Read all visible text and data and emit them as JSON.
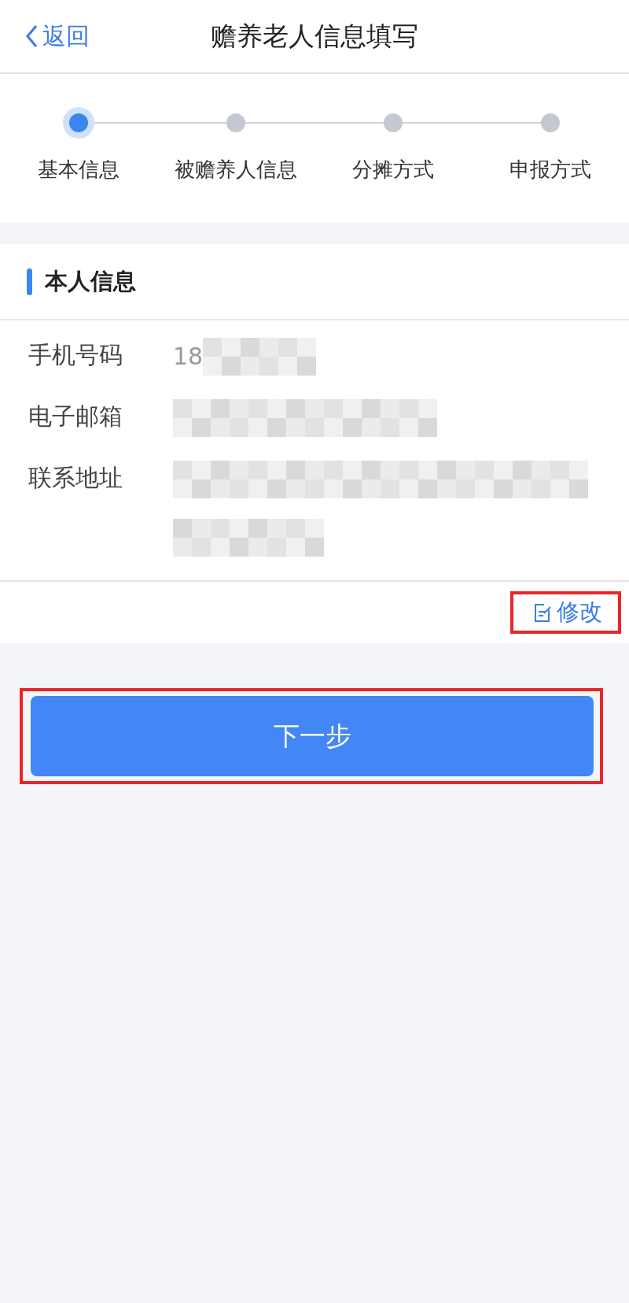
{
  "nav": {
    "back": "返回",
    "title": "赡养老人信息填写"
  },
  "steps": [
    {
      "label": "基本信息",
      "selected": true
    },
    {
      "label": "被赡养人信息",
      "selected": false
    },
    {
      "label": "分摊方式",
      "selected": false
    },
    {
      "label": "申报方式",
      "selected": false
    }
  ],
  "section": {
    "title": "本人信息"
  },
  "fields": [
    {
      "label": "手机号码",
      "value": "18"
    },
    {
      "label": "电子邮箱"
    },
    {
      "label": "联系地址"
    }
  ],
  "edit": {
    "label": "修改",
    "highlighted": true
  },
  "next": {
    "label": "下一步",
    "highlighted": true
  }
}
